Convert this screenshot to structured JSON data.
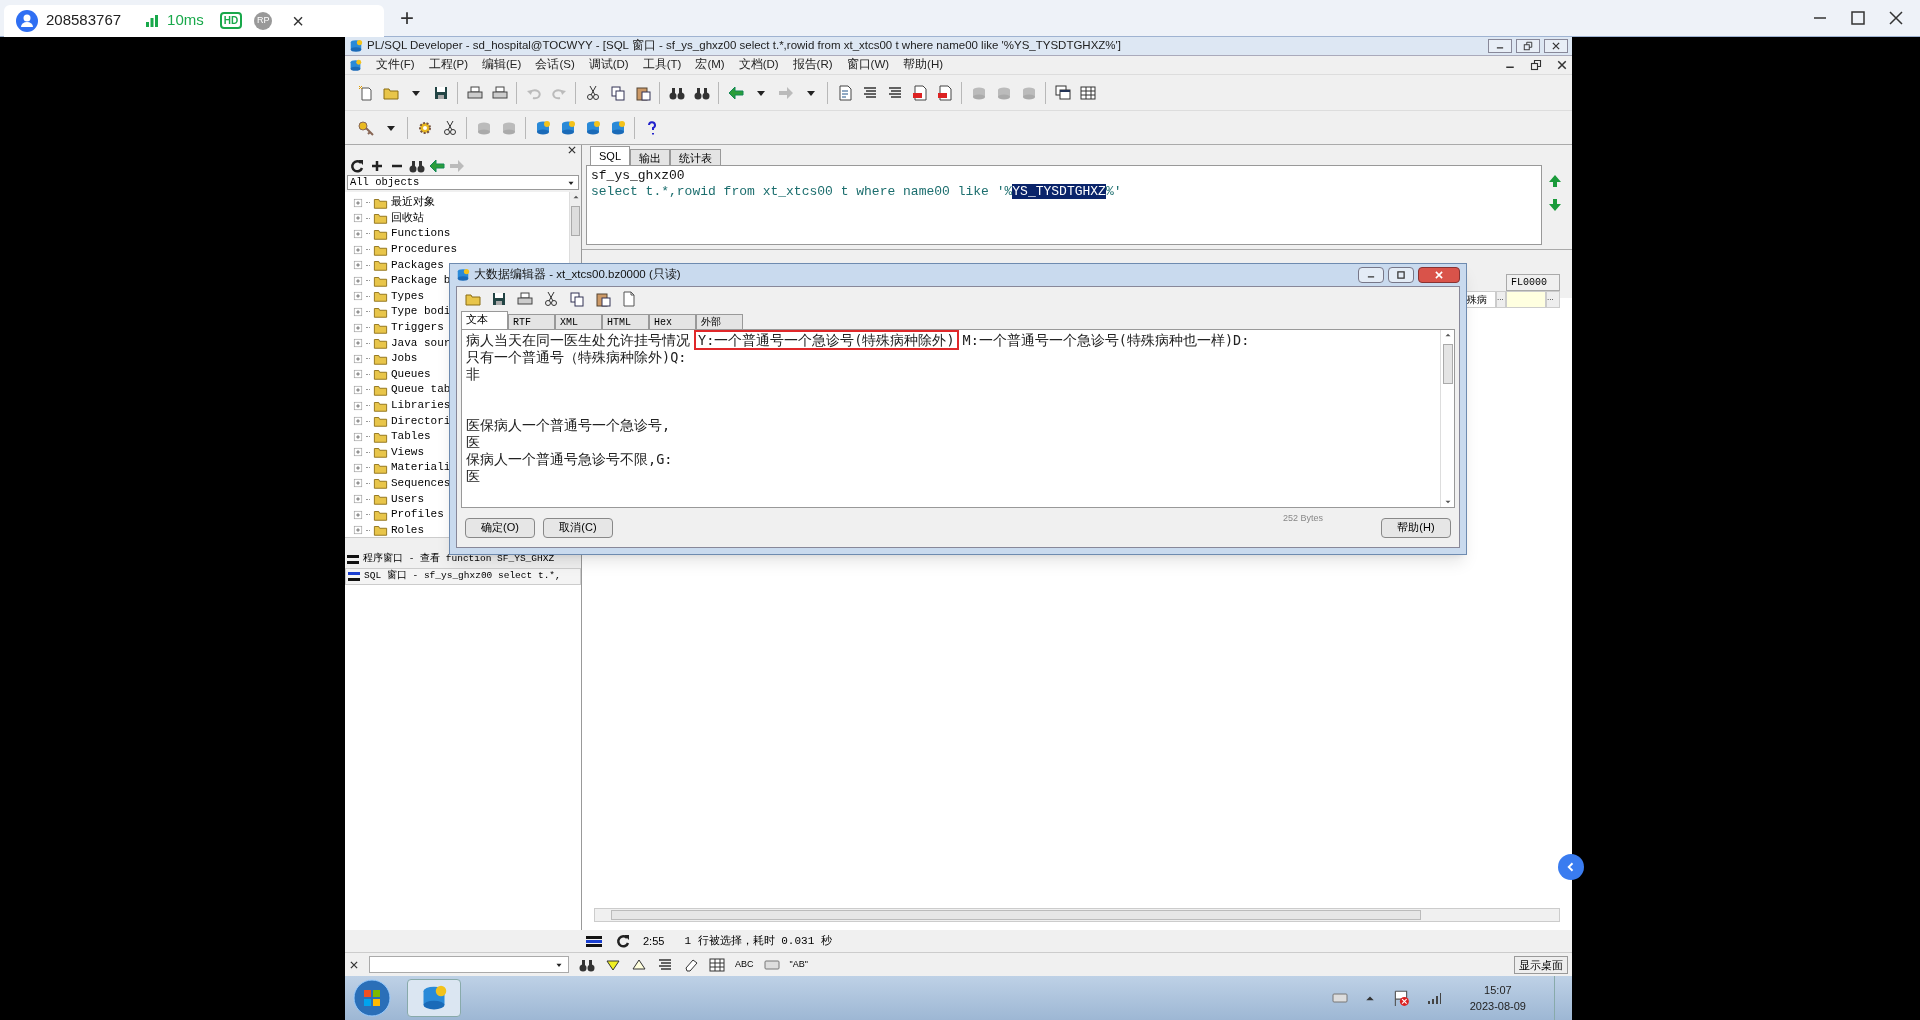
{
  "browser_tab": {
    "title": "208583767",
    "ping": "10ms",
    "hd": "HD",
    "rp": "RP",
    "close": "×",
    "new_tab": "+"
  },
  "app": {
    "title": "PL/SQL Developer - sd_hospital@TOCWYY - [SQL 窗口 - sf_ys_ghxz00 select t.*,rowid from xt_xtcs00 t where name00 like '%YS_TYSDTGHXZ%']",
    "menu": [
      {
        "label": "文件(F)",
        "disabled": false
      },
      {
        "label": "工程(P)",
        "disabled": false
      },
      {
        "label": "编辑(E)",
        "disabled": false
      },
      {
        "label": "会话(S)",
        "disabled": false
      },
      {
        "label": "调试(D)",
        "disabled": false
      },
      {
        "label": "工具(T)",
        "disabled": false
      },
      {
        "label": "宏(M)",
        "disabled": false
      },
      {
        "label": "文档(D)",
        "disabled": false
      },
      {
        "label": "报告(R)",
        "disabled": false
      },
      {
        "label": "窗口(W)",
        "disabled": false
      },
      {
        "label": "帮助(H)",
        "disabled": false
      }
    ]
  },
  "object_browser": {
    "filter": "All objects",
    "items": [
      {
        "label": "最近对象"
      },
      {
        "label": "回收站"
      },
      {
        "label": "Functions"
      },
      {
        "label": "Procedures"
      },
      {
        "label": "Packages"
      },
      {
        "label": "Package b"
      },
      {
        "label": "Types"
      },
      {
        "label": "Type bodi"
      },
      {
        "label": "Triggers"
      },
      {
        "label": "Java sour"
      },
      {
        "label": "Jobs"
      },
      {
        "label": "Queues"
      },
      {
        "label": "Queue tab"
      },
      {
        "label": "Libraries"
      },
      {
        "label": "Directori"
      },
      {
        "label": "Tables"
      },
      {
        "label": "Views"
      },
      {
        "label": "Materiali"
      },
      {
        "label": "Sequences"
      },
      {
        "label": "Users"
      },
      {
        "label": "Profiles"
      },
      {
        "label": "Roles"
      }
    ]
  },
  "window_list": [
    {
      "label": "程序窗口 - 查看 function SF_YS_GHXZ",
      "selected": false
    },
    {
      "label": "SQL 窗口 - sf_ys_ghxz00 select t.*,",
      "selected": true
    }
  ],
  "sql_tabs": [
    {
      "label": "SQL",
      "selected": true
    },
    {
      "label": "输出",
      "selected": false
    },
    {
      "label": "统计表",
      "selected": false
    }
  ],
  "sql_editor": {
    "line_1": "sf_ys_ghxz00",
    "line_2": [
      {
        "text": "select t.*,rowid from xt_xtcs00 t where name00 like '%",
        "highlighted": false
      },
      {
        "text": "YS_TYSDTGHXZ",
        "highlighted": true
      },
      {
        "text": "%'",
        "highlighted": false
      }
    ]
  },
  "results": {
    "column_header": "FL0000",
    "cell_1": "殊病",
    "cell_2": "...",
    "cell_3": "..."
  },
  "dialog": {
    "title": "大数据编辑器 - xt_xtcs00.bz0000 (只读)",
    "tabs": [
      {
        "label": "文本",
        "selected": true
      },
      {
        "label": "RTF",
        "selected": false
      },
      {
        "label": "XML",
        "selected": false
      },
      {
        "label": "HTML",
        "selected": false
      },
      {
        "label": "Hex",
        "selected": false
      },
      {
        "label": "外部",
        "selected": false
      }
    ],
    "line_1": [
      {
        "text": "病人当天在同一医生处允许挂号情况",
        "boxed": false
      },
      {
        "text": "Y:一个普通号一个急诊号(特殊病种除外)",
        "boxed": true
      },
      {
        "text": "M:一个普通号一个急诊号(特殊病种也一样)D:",
        "boxed": false
      }
    ],
    "paragraphs": [
      [
        "只有一个普通号（特殊病种除外)Q:",
        "非"
      ],
      [
        "医保病人一个普通号一个急诊号,",
        "医",
        "保病人一个普通号急诊号不限,G:",
        "医"
      ]
    ],
    "size": "252 Bytes",
    "ok": "确定(O)",
    "cancel": "取消(C)",
    "help": "帮助(H)"
  },
  "status": {
    "time": "2:55",
    "message": "1 行被选择，耗时 0.031 秒"
  },
  "find_bar": {
    "abc": "ABC",
    "quoted": "\"AB\""
  },
  "taskbar": {
    "show_desktop": "显示桌面",
    "time": "15:07",
    "date": "2023-08-09"
  }
}
